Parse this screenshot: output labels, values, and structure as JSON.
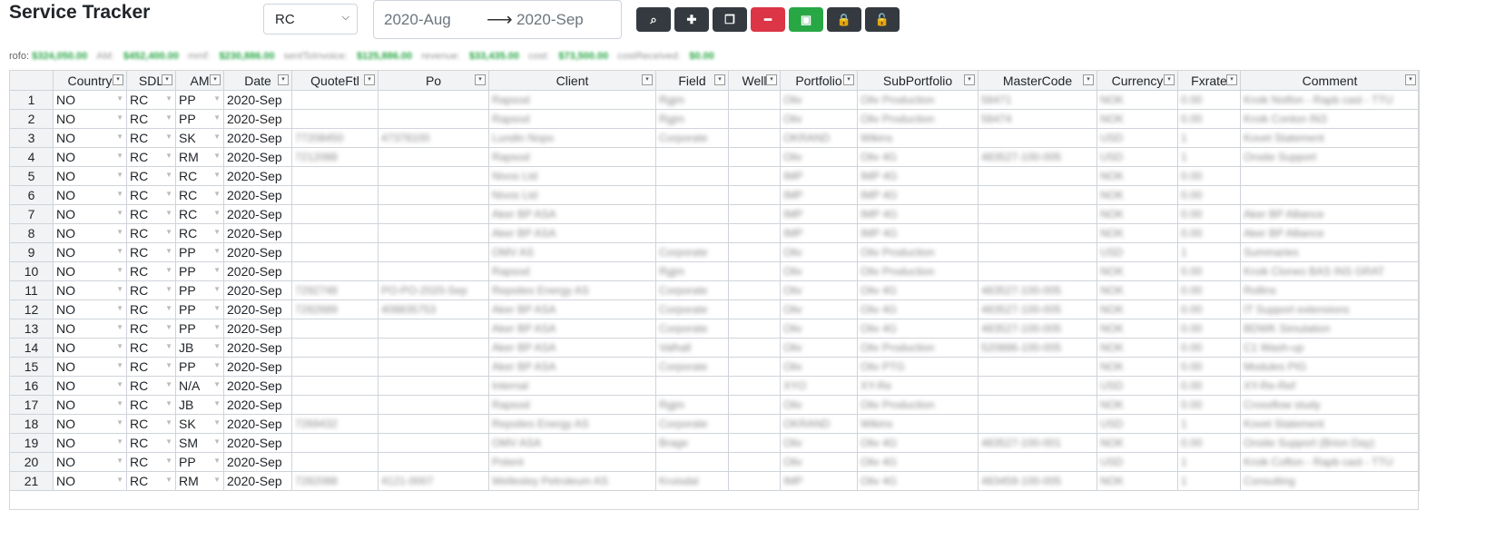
{
  "app": {
    "title": "Service Tracker"
  },
  "filter": {
    "selected": "RC"
  },
  "date_range": {
    "from": "2020-Aug",
    "arrow": "⟶",
    "to": "2020-Sep"
  },
  "toolbar": [
    {
      "name": "search-button",
      "icon": "search-icon",
      "glyph": "⌕",
      "style": "dark"
    },
    {
      "name": "add-button",
      "icon": "plus-icon",
      "glyph": "✚",
      "style": "dark"
    },
    {
      "name": "copy-button",
      "icon": "copy-icon",
      "glyph": "❐",
      "style": "dark"
    },
    {
      "name": "remove-button",
      "icon": "minus-icon",
      "glyph": "━",
      "style": "red"
    },
    {
      "name": "save-button",
      "icon": "save-icon",
      "glyph": "▣",
      "style": "green"
    },
    {
      "name": "lock-button",
      "icon": "lock-icon",
      "glyph": "🔒",
      "style": "dark"
    },
    {
      "name": "unlock-button",
      "icon": "unlock-icon",
      "glyph": "🔓",
      "style": "dark"
    }
  ],
  "summary": {
    "label": "rofo:",
    "blurred_items": [
      {
        "type": "value",
        "text": "$324,050.00"
      },
      {
        "type": "label",
        "text": "AM:"
      },
      {
        "type": "value",
        "text": "$452,400.00"
      },
      {
        "type": "label",
        "text": "mmf:"
      },
      {
        "type": "value",
        "text": "$230,886.00"
      },
      {
        "type": "label",
        "text": "sentToInvoice:"
      },
      {
        "type": "value",
        "text": "$125,886.00"
      },
      {
        "type": "label",
        "text": "revenue:"
      },
      {
        "type": "value",
        "text": "$33,435.00"
      },
      {
        "type": "label",
        "text": "cost:"
      },
      {
        "type": "value",
        "text": "$73,500.00"
      },
      {
        "type": "label",
        "text": "costReceived:"
      },
      {
        "type": "value",
        "text": "$0.00"
      }
    ]
  },
  "table": {
    "columns": [
      "Country",
      "SDL",
      "AM",
      "Date",
      "QuoteFtl",
      "Po",
      "Client",
      "Field",
      "Well",
      "Portfolio",
      "SubPortfolio",
      "MasterCode",
      "Currency",
      "Fxrate",
      "Comment"
    ],
    "rows": [
      {
        "n": "1",
        "country": "NO",
        "sdl": "RC",
        "am": "PP",
        "date": "2020-Sep",
        "blur": [
          "",
          "",
          "Rapsod",
          "Rgjm",
          "",
          "Oliv",
          "Oliv Production",
          "58471",
          "NOK",
          "0.00",
          "Kroik Notfon - Rapb cast - TTU"
        ]
      },
      {
        "n": "2",
        "country": "NO",
        "sdl": "RC",
        "am": "PP",
        "date": "2020-Sep",
        "blur": [
          "",
          "",
          "Rapsod",
          "Rgjm",
          "",
          "Oliv",
          "Oliv Production",
          "58474",
          "NOK",
          "0.00",
          "Kroik Conton IN3"
        ]
      },
      {
        "n": "3",
        "country": "NO",
        "sdl": "RC",
        "am": "SK",
        "date": "2020-Sep",
        "blur": [
          "77208450",
          "47378100",
          "Lundin Nopo",
          "Corporate",
          "",
          "OKRAND",
          "Wikins",
          "",
          "USD",
          "1",
          "Kovet Statement"
        ]
      },
      {
        "n": "4",
        "country": "NO",
        "sdl": "RC",
        "am": "RM",
        "date": "2020-Sep",
        "blur": [
          "7212088",
          "",
          "Rapsod",
          "",
          "",
          "Oliv",
          "Oliv 4G",
          "483527-100-005",
          "USD",
          "1",
          "Onsite Support"
        ]
      },
      {
        "n": "5",
        "country": "NO",
        "sdl": "RC",
        "am": "RC",
        "date": "2020-Sep",
        "blur": [
          "",
          "",
          "Nivos Ltd",
          "",
          "",
          "IMP",
          "IMP 4G",
          "",
          "NOK",
          "0.00",
          ""
        ]
      },
      {
        "n": "6",
        "country": "NO",
        "sdl": "RC",
        "am": "RC",
        "date": "2020-Sep",
        "blur": [
          "",
          "",
          "Nivos Ltd",
          "",
          "",
          "IMP",
          "IMP 4G",
          "",
          "NOK",
          "0.00",
          ""
        ]
      },
      {
        "n": "7",
        "country": "NO",
        "sdl": "RC",
        "am": "RC",
        "date": "2020-Sep",
        "blur": [
          "",
          "",
          "Aker BP ASA",
          "",
          "",
          "IMP",
          "IMP 4G",
          "",
          "NOK",
          "0.00",
          "Aker BP Alliance"
        ]
      },
      {
        "n": "8",
        "country": "NO",
        "sdl": "RC",
        "am": "RC",
        "date": "2020-Sep",
        "blur": [
          "",
          "",
          "Aker BP ASA",
          "",
          "",
          "IMP",
          "IMP 4G",
          "",
          "NOK",
          "0.00",
          "Aker BP Alliance"
        ]
      },
      {
        "n": "9",
        "country": "NO",
        "sdl": "RC",
        "am": "PP",
        "date": "2020-Sep",
        "blur": [
          "",
          "",
          "OMV AS",
          "Corporate",
          "",
          "Oliv",
          "Oliv Production",
          "",
          "USD",
          "1",
          "Summaries"
        ]
      },
      {
        "n": "10",
        "country": "NO",
        "sdl": "RC",
        "am": "PP",
        "date": "2020-Sep",
        "blur": [
          "",
          "",
          "Rapsod",
          "Rgjm",
          "",
          "Oliv",
          "Oliv Production",
          "",
          "NOK",
          "0.00",
          "Kroik Cloneo BAS INS GRAT"
        ]
      },
      {
        "n": "11",
        "country": "NO",
        "sdl": "RC",
        "am": "PP",
        "date": "2020-Sep",
        "blur": [
          "7292748",
          "PO-PO-2020-Sep",
          "Repsites Energy AS",
          "Corporate",
          "",
          "Oliv",
          "Oliv 4G",
          "483527-100-005",
          "NOK",
          "0.00",
          "Rollins"
        ]
      },
      {
        "n": "12",
        "country": "NO",
        "sdl": "RC",
        "am": "PP",
        "date": "2020-Sep",
        "blur": [
          "7282689",
          "408835753",
          "Aker BP ASA",
          "Corporate",
          "",
          "Oliv",
          "Oliv 4G",
          "483527-100-005",
          "NOK",
          "0.00",
          "IT Support extensions"
        ]
      },
      {
        "n": "13",
        "country": "NO",
        "sdl": "RC",
        "am": "PP",
        "date": "2020-Sep",
        "blur": [
          "",
          "",
          "Aker BP ASA",
          "Corporate",
          "",
          "Oliv",
          "Oliv 4G",
          "483527-100-005",
          "NOK",
          "0.00",
          "BDWK Simulation"
        ]
      },
      {
        "n": "14",
        "country": "NO",
        "sdl": "RC",
        "am": "JB",
        "date": "2020-Sep",
        "blur": [
          "",
          "",
          "Aker BP ASA",
          "Valhall",
          "",
          "Oliv",
          "Oliv Production",
          "520886-100-005",
          "NOK",
          "0.00",
          "C1 Wash-up"
        ]
      },
      {
        "n": "15",
        "country": "NO",
        "sdl": "RC",
        "am": "PP",
        "date": "2020-Sep",
        "blur": [
          "",
          "",
          "Aker BP ASA",
          "Corporate",
          "",
          "Oliv",
          "Oliv PTG",
          "",
          "NOK",
          "0.00",
          "Modules PIG"
        ]
      },
      {
        "n": "16",
        "country": "NO",
        "sdl": "RC",
        "am": "N/A",
        "date": "2020-Sep",
        "blur": [
          "",
          "",
          "Internal",
          "",
          "",
          "XYO",
          "XY-Re",
          "",
          "USD",
          "0.00",
          "XY-Re-Ref"
        ]
      },
      {
        "n": "17",
        "country": "NO",
        "sdl": "RC",
        "am": "JB",
        "date": "2020-Sep",
        "blur": [
          "",
          "",
          "Rapsod",
          "Rgjm",
          "",
          "Oliv",
          "Oliv Production",
          "",
          "NOK",
          "0.00",
          "Crossflow study"
        ]
      },
      {
        "n": "18",
        "country": "NO",
        "sdl": "RC",
        "am": "SK",
        "date": "2020-Sep",
        "blur": [
          "7269432",
          "",
          "Repsites Energy AS",
          "Corporate",
          "",
          "OKRAND",
          "Wikins",
          "",
          "USD",
          "1",
          "Kovet Statement"
        ]
      },
      {
        "n": "19",
        "country": "NO",
        "sdl": "RC",
        "am": "SM",
        "date": "2020-Sep",
        "blur": [
          "",
          "",
          "OMV ASA",
          "Brage",
          "",
          "Oliv",
          "Oliv 4G",
          "483527-100-001",
          "NOK",
          "0.00",
          "Onsite Support (Brion Day)"
        ]
      },
      {
        "n": "20",
        "country": "NO",
        "sdl": "RC",
        "am": "PP",
        "date": "2020-Sep",
        "blur": [
          "",
          "",
          "Potent",
          "",
          "",
          "Oliv",
          "Oliv 4G",
          "",
          "USD",
          "1",
          "Kroik Cofton - Rapb cast - TTU"
        ]
      },
      {
        "n": "21",
        "country": "NO",
        "sdl": "RC",
        "am": "RM",
        "date": "2020-Sep",
        "blur": [
          "7282088",
          "4121-0007",
          "Wellesley Petroleum AS",
          "Kruisdal",
          "",
          "IMP",
          "Oliv 4G",
          "483459-100-005",
          "NOK",
          "1",
          "Consulting"
        ]
      }
    ]
  }
}
